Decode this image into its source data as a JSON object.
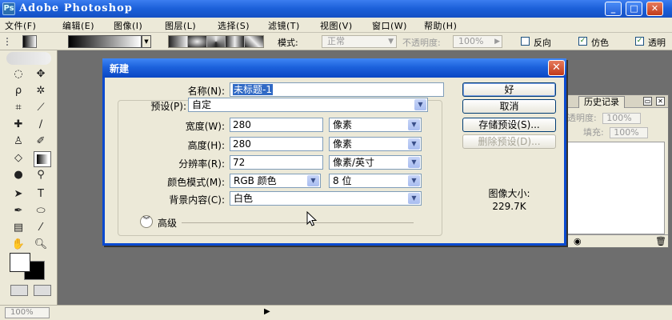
{
  "window": {
    "title": "Adobe Photoshop",
    "buttons": [
      "_",
      "□",
      "✕"
    ]
  },
  "menu": [
    "文件(F)",
    "编辑(E)",
    "图像(I)",
    "图层(L)",
    "选择(S)",
    "滤镜(T)",
    "视图(V)",
    "窗口(W)",
    "帮助(H)"
  ],
  "options": {
    "mode_label": "模式:",
    "mode_value": "正常",
    "opacity_label": "不透明度:",
    "opacity_value": "100%",
    "reverse_label": "反向",
    "dither_label": "仿色",
    "transparency_label": "透明"
  },
  "dialog": {
    "title": "新建",
    "close": "✕",
    "name_label": "名称(N):",
    "name_value": "未标题-1",
    "preset_label": "预设(P):",
    "preset_value": "自定",
    "width_label": "宽度(W):",
    "width_value": "280",
    "width_unit": "像素",
    "height_label": "高度(H):",
    "height_value": "280",
    "height_unit": "像素",
    "resolution_label": "分辨率(R):",
    "resolution_value": "72",
    "resolution_unit": "像素/英寸",
    "color_mode_label": "颜色模式(M):",
    "color_mode_value": "RGB 颜色",
    "bit_depth": "8 位",
    "background_label": "背景内容(C):",
    "background_value": "白色",
    "advanced_label": "高级",
    "ok": "好",
    "cancel": "取消",
    "save_preset": "存储预设(S)...",
    "delete_preset": "删除预设(D)...",
    "image_size_label": "图像大小:",
    "image_size_value": "229.7K"
  },
  "palette": {
    "tab": "历史记录",
    "opacity_label": "透明度:",
    "opacity_value": "100%",
    "fill_label": "填充:",
    "fill_value": "100%"
  },
  "status": {
    "zoom": "100%",
    "arrow": "▶"
  }
}
